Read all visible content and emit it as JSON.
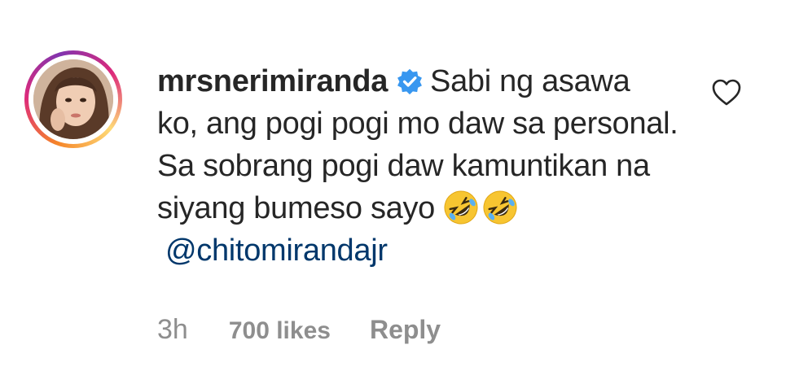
{
  "comment": {
    "username": "mrsnerimiranda",
    "verified": true,
    "text": "Sabi ng asawa ko, ang pogi pogi mo daw sa personal. Sa sobrang pogi daw kamuntikan na siyang bumeso sayo",
    "emojis": [
      "rolling-on-floor-laughing",
      "rolling-on-floor-laughing"
    ],
    "mention": "@chitomirandajr",
    "time": "3h",
    "likes": "700 likes",
    "reply_label": "Reply"
  },
  "colors": {
    "text": "#262626",
    "secondary": "#8e8e8e",
    "mention": "#00376b",
    "verified": "#3897f0",
    "emoji": "#f7c531"
  },
  "icons": {
    "verified": "verified-badge-icon",
    "like": "heart-outline-icon",
    "emoji": "rolling-on-floor-laughing-emoji"
  }
}
